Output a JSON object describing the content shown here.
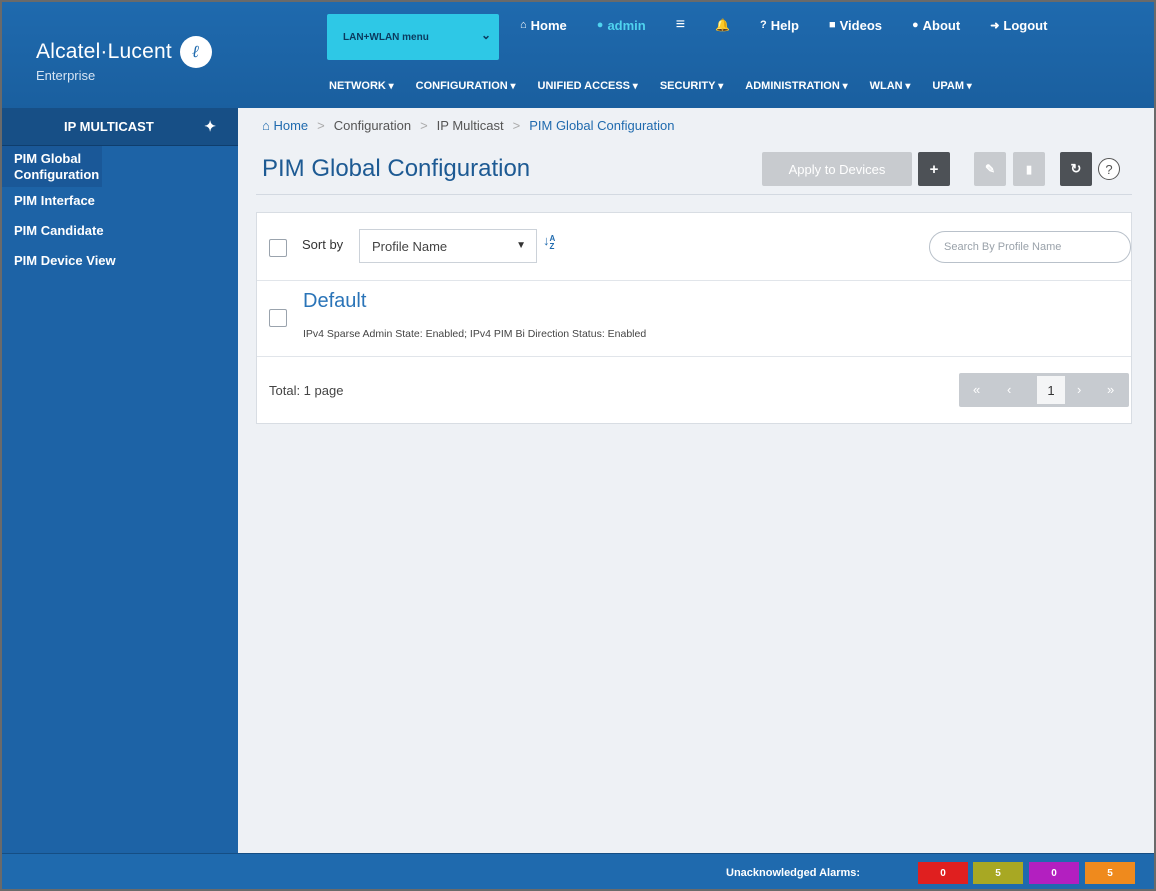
{
  "brand": {
    "name": "Alcatel·Lucent",
    "mark": "ℓ",
    "sub": "Enterprise"
  },
  "header": {
    "menu_select": "LAN+WLAN menu",
    "toplinks": [
      {
        "icon": "home-icon",
        "glyph": "⌂",
        "label": "Home"
      },
      {
        "icon": "user-icon",
        "glyph": "●",
        "label": "admin"
      },
      {
        "icon": "list-icon",
        "glyph": "≡",
        "label": ""
      },
      {
        "icon": "bell-icon",
        "glyph": "🔔",
        "label": ""
      },
      {
        "icon": "question-icon",
        "glyph": "?",
        "label": "Help"
      },
      {
        "icon": "video-icon",
        "glyph": "■",
        "label": "Videos"
      },
      {
        "icon": "info-icon",
        "glyph": "●",
        "label": "About"
      },
      {
        "icon": "logout-icon",
        "glyph": "➜",
        "label": "Logout"
      }
    ],
    "nav": [
      "NETWORK",
      "CONFIGURATION",
      "UNIFIED ACCESS",
      "SECURITY",
      "ADMINISTRATION",
      "WLAN",
      "UPAM"
    ]
  },
  "sidebar": {
    "title": "IP MULTICAST",
    "items": [
      {
        "label": "PIM Global Configuration",
        "active": true
      },
      {
        "label": "PIM Interface",
        "active": false
      },
      {
        "label": "PIM Candidate",
        "active": false
      },
      {
        "label": "PIM Device View",
        "active": false
      }
    ]
  },
  "breadcrumb": {
    "home": "Home",
    "items": [
      "Configuration",
      "IP Multicast"
    ],
    "current": "PIM Global Configuration"
  },
  "page": {
    "title": "PIM Global Configuration",
    "apply_label": "Apply to Devices",
    "help_label": "?"
  },
  "list": {
    "sort_label": "Sort by",
    "sort_value": "Profile Name",
    "sort_az_top": "A",
    "sort_az_bottom": "Z",
    "search_placeholder": "Search By Profile Name",
    "rows": [
      {
        "title": "Default",
        "desc": "IPv4 Sparse Admin State: Enabled; IPv4 PIM Bi Direction Status: Enabled"
      }
    ],
    "total": "Total: 1 page",
    "page": "1"
  },
  "footer": {
    "alarm_label": "Unacknowledged Alarms:",
    "alarms": [
      {
        "value": "0",
        "color": "#e01f1f"
      },
      {
        "value": "5",
        "color": "#a8a823"
      },
      {
        "value": "0",
        "color": "#b31fc0"
      },
      {
        "value": "5",
        "color": "#ef8a1d"
      }
    ]
  }
}
